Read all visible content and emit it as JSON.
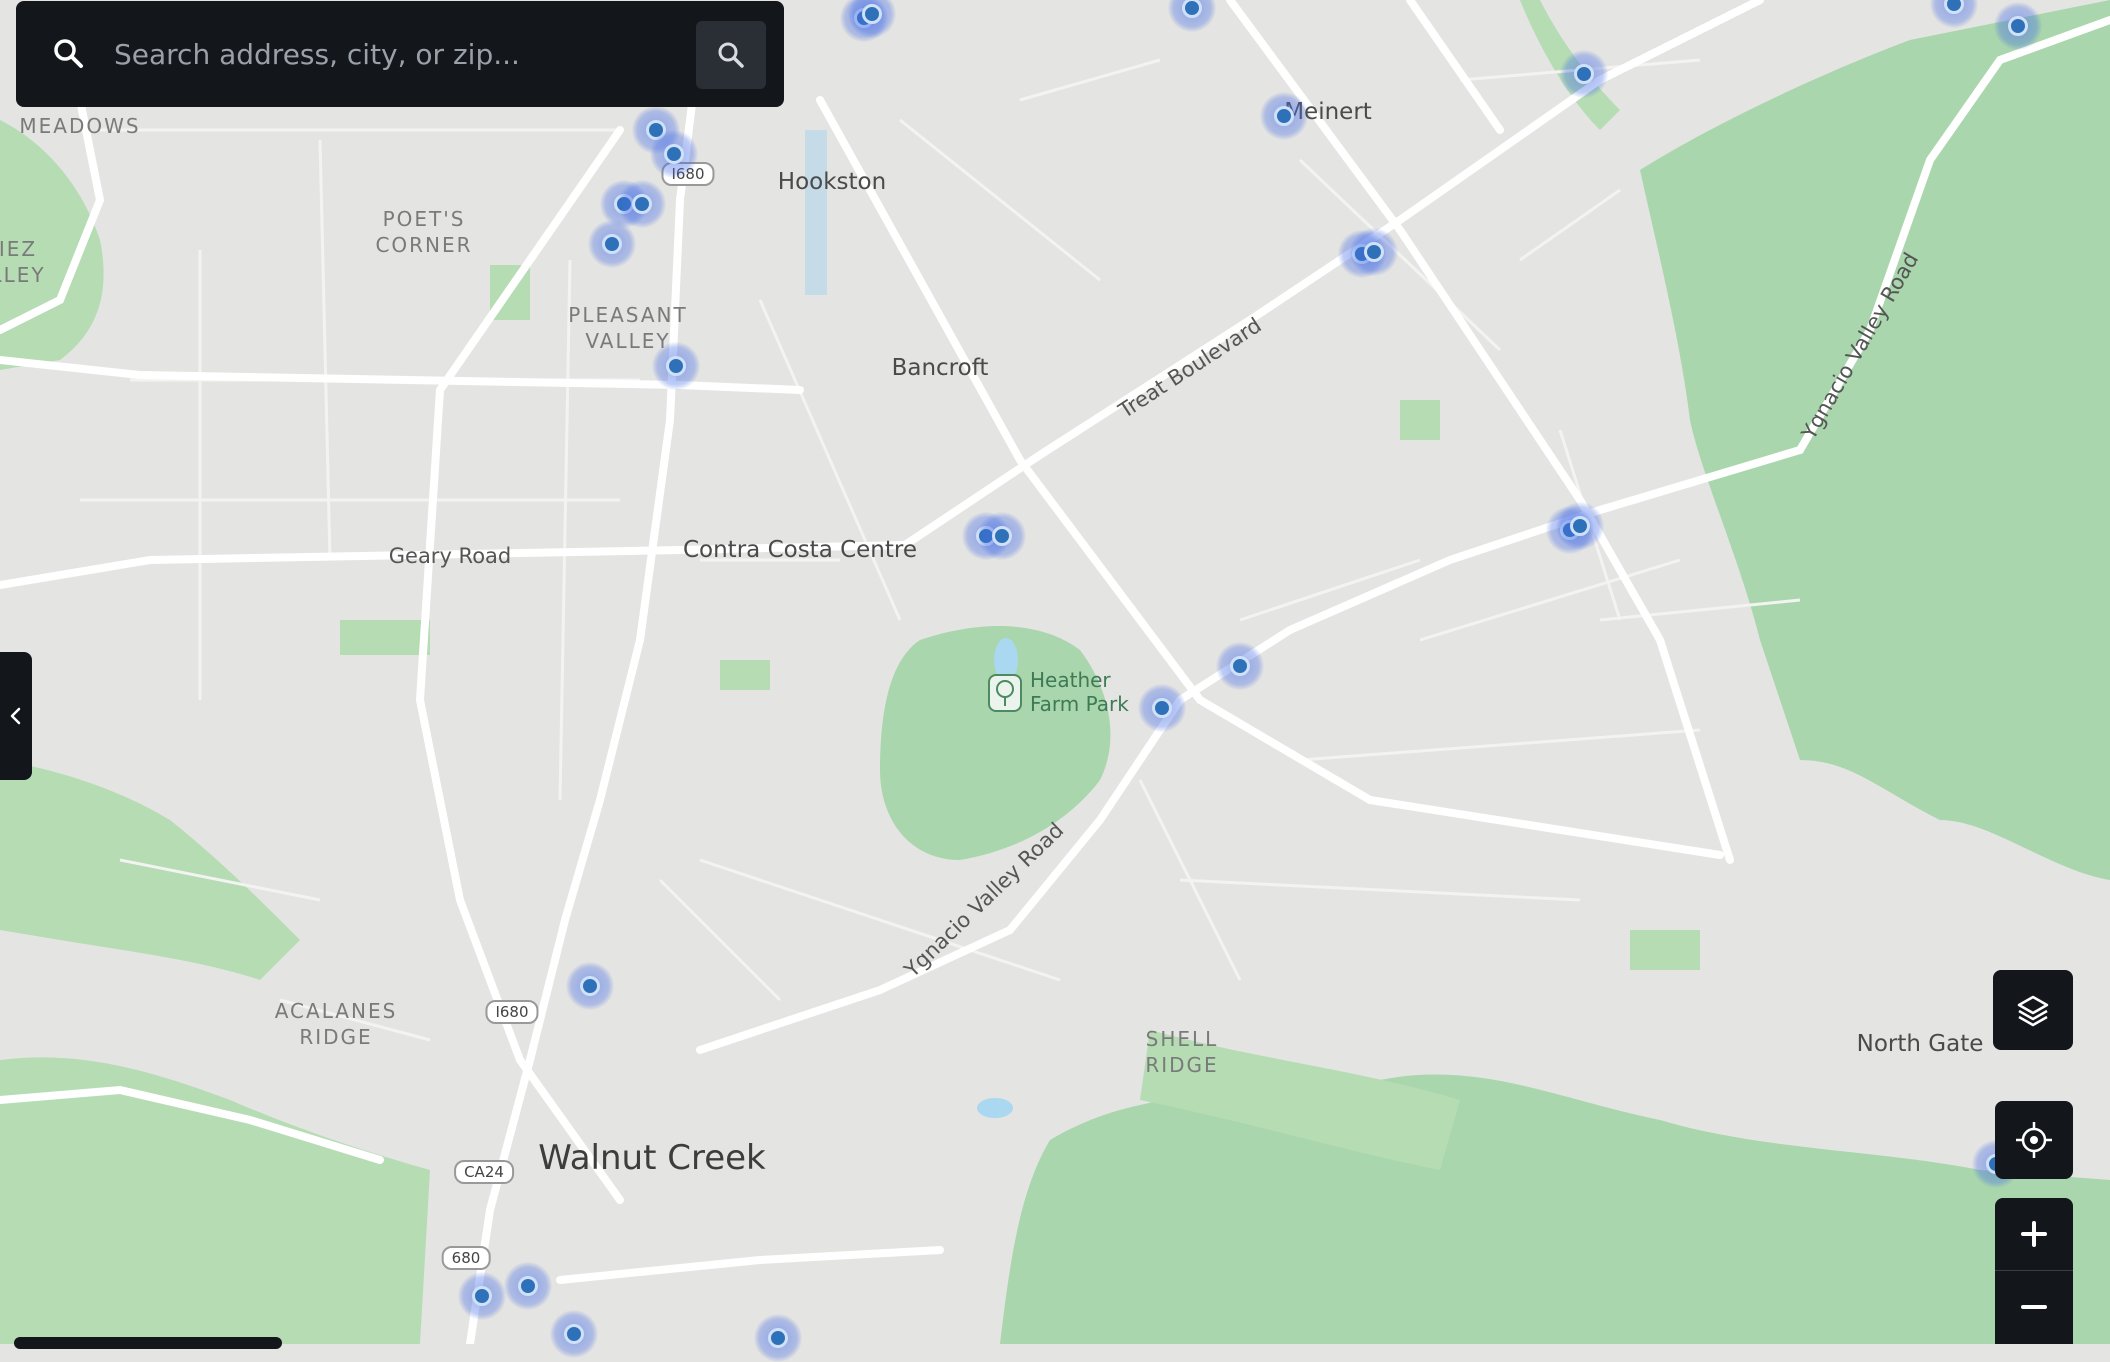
{
  "search": {
    "placeholder": "Search address, city, or zip...",
    "value": "",
    "left_icon": "search-icon",
    "button_icon": "search-icon"
  },
  "map": {
    "area_labels": [
      {
        "id": "meadows",
        "text": "MEADOWS"
      },
      {
        "id": "poets-corner",
        "text": "POET'S\nCORNER"
      },
      {
        "id": "pleasant-valley",
        "text": "PLEASANT\nVALLEY"
      },
      {
        "id": "iez-lley",
        "text": "IEZ\nLLEY"
      },
      {
        "id": "acalanes-ridge",
        "text": "ACALANES\nRIDGE"
      },
      {
        "id": "shell-ridge",
        "text": "SHELL\nRIDGE"
      }
    ],
    "place_labels": [
      {
        "id": "hookston",
        "text": "Hookston"
      },
      {
        "id": "bancroft",
        "text": "Bancroft"
      },
      {
        "id": "contra-costa-centre",
        "text": "Contra Costa Centre"
      },
      {
        "id": "meinert",
        "text": "Meinert"
      },
      {
        "id": "north-gate",
        "text": "North Gate"
      }
    ],
    "city_label": "Walnut Creek",
    "road_labels": [
      {
        "id": "geary-road",
        "text": "Geary Road"
      },
      {
        "id": "treat-boulevard",
        "text": "Treat Boulevard"
      },
      {
        "id": "ygnacio-valley-road-1",
        "text": "Ygnacio Valley Road"
      },
      {
        "id": "ygnacio-valley-road-2",
        "text": "Ygnacio Valley Road"
      }
    ],
    "shields": [
      {
        "id": "i680-north",
        "text": "I680"
      },
      {
        "id": "i680-mid",
        "text": "I680"
      },
      {
        "id": "ca24",
        "text": "CA24"
      },
      {
        "id": "r680-south",
        "text": "680"
      }
    ],
    "park": {
      "name": "Heather\nFarm Park",
      "icon": "tree-icon"
    },
    "marker_count": 27
  },
  "controls": {
    "layers_icon": "layers-icon",
    "locate_icon": "locate-icon",
    "zoom_in_icon": "plus-icon",
    "zoom_out_icon": "minus-icon",
    "sidebar_toggle_icon": "chevron-left-icon"
  },
  "colors": {
    "land": "#e4e4e2",
    "green": "#a9d6ac",
    "dark_green": "#8fc79a",
    "road": "#ffffff",
    "water": "#a9d8f0",
    "ui_dark": "#13161b",
    "marker": "#2f71b8"
  }
}
